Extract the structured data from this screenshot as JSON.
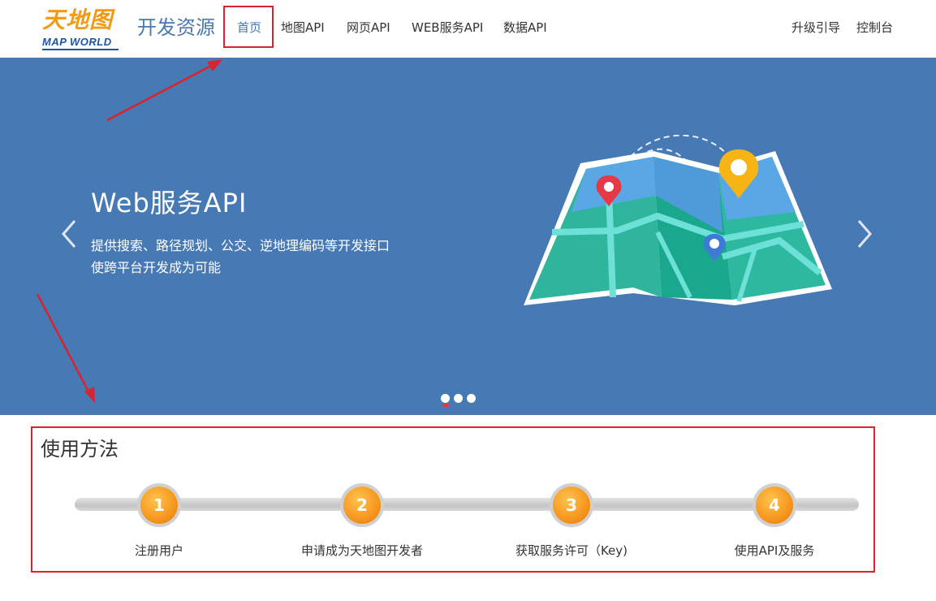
{
  "header": {
    "logo_cn": "天地图",
    "logo_en": "MAP WORLD",
    "site_title": "开发资源",
    "nav": [
      {
        "label": "首页"
      },
      {
        "label": "地图API"
      },
      {
        "label": "网页API"
      },
      {
        "label": "WEB服务API"
      },
      {
        "label": "数据API"
      }
    ],
    "right_nav": [
      {
        "label": "升级引导"
      },
      {
        "label": "控制台"
      }
    ]
  },
  "banner": {
    "title": "Web服务API",
    "desc_line1": "提供搜索、路径规划、公交、逆地理编码等开发接口",
    "desc_line2": "使跨平台开发成为可能",
    "active_slide": 1,
    "slide_count": 3
  },
  "steps": {
    "title": "使用方法",
    "items": [
      {
        "number": "1",
        "label": "注册用户"
      },
      {
        "number": "2",
        "label": "申请成为天地图开发者"
      },
      {
        "number": "3",
        "label": "获取服务许可（Key)"
      },
      {
        "number": "4",
        "label": "使用API及服务"
      }
    ]
  },
  "colors": {
    "banner_bg": "#4779b4",
    "accent": "#3f77b5",
    "annotation_red": "#d9232d",
    "step_orange": "#f5921a"
  }
}
